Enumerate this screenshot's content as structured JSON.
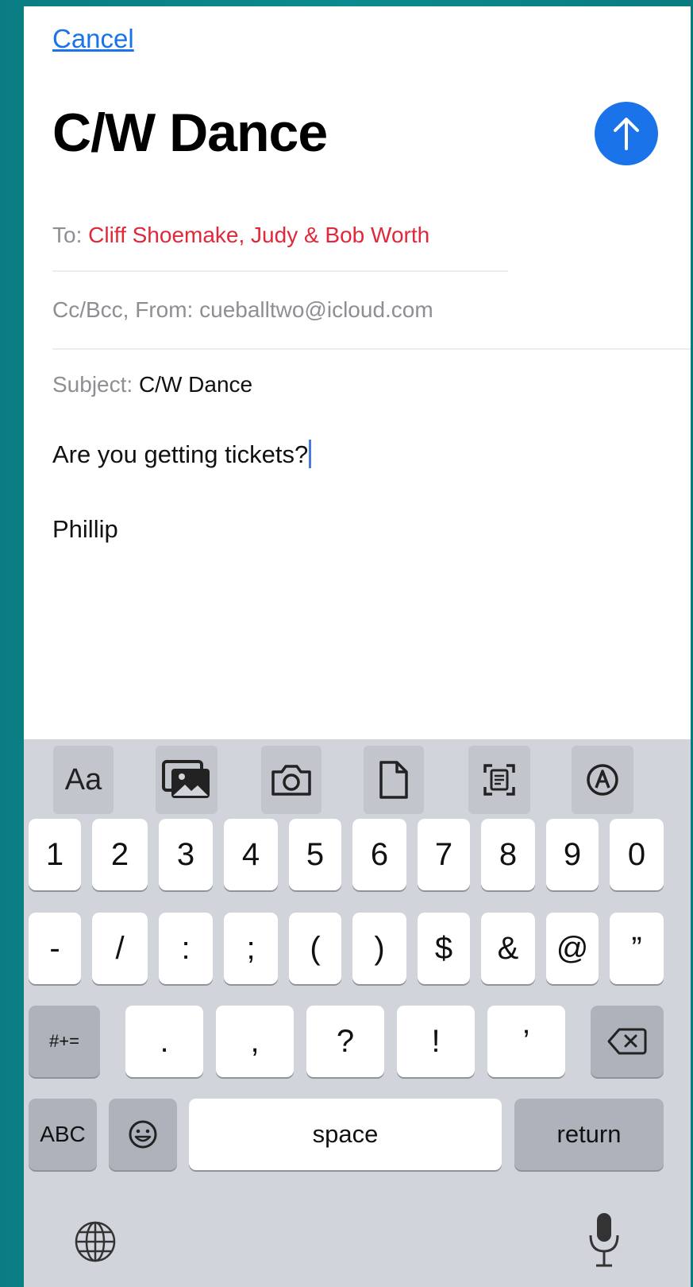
{
  "compose": {
    "cancel_label": "Cancel",
    "title": "C/W Dance",
    "to_label": "To:",
    "to_value": "Cliff Shoemake, Judy & Bob Worth",
    "cc_label": "Cc/Bcc, From:",
    "cc_value": "cueballtwo@icloud.com",
    "subject_label": "Subject:",
    "subject_value": "C/W Dance",
    "body_line1": "Are you getting tickets?",
    "body_line2": "Phillip"
  },
  "colors": {
    "accent": "#1a73e8",
    "recipient": "#e0283a",
    "keyboard_bg": "#d1d4da"
  },
  "toolbar": {
    "format_label": "Aa",
    "icons": [
      "photo-library-icon",
      "camera-icon",
      "document-icon",
      "scan-document-icon",
      "markup-icon"
    ]
  },
  "keyboard": {
    "row1": [
      "1",
      "2",
      "3",
      "4",
      "5",
      "6",
      "7",
      "8",
      "9",
      "0"
    ],
    "row2": [
      "-",
      "/",
      ":",
      ";",
      "(",
      ")",
      "$",
      "&",
      "@",
      "”"
    ],
    "row3_mode": "#+=",
    "row3": [
      ".",
      ",",
      "?",
      "!",
      "’"
    ],
    "abc_label": "ABC",
    "space_label": "space",
    "return_label": "return"
  }
}
